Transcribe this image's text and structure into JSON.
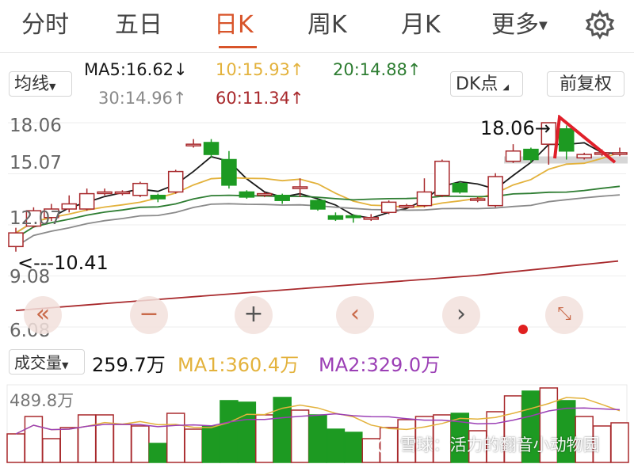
{
  "tabs": [
    {
      "label": "分时",
      "active": false
    },
    {
      "label": "五日",
      "active": false
    },
    {
      "label": "日K",
      "active": true
    },
    {
      "label": "周K",
      "active": false
    },
    {
      "label": "月K",
      "active": false
    },
    {
      "label": "更多",
      "active": false
    }
  ],
  "toolbar": {
    "indicator_label": "均线",
    "dk_label": "DK点",
    "adjust_label": "前复权",
    "ma5": "MA5:16.62↓",
    "ma10": "10:15.93↑",
    "ma20": "20:14.88↑",
    "ma30": "30:14.96↑",
    "ma60": "60:11.34↑"
  },
  "price_axis": [
    "18.06",
    "15.07",
    "12.07",
    "9.08",
    "6.08"
  ],
  "annotations": {
    "high": "18.06→",
    "low": "<---10.41"
  },
  "volume": {
    "label": "成交量",
    "value": "259.7万",
    "ma1": "MA1:360.4万",
    "ma2": "MA2:329.0万",
    "axis_max": "489.8万"
  },
  "watermark": "雪球：活力的翻音小动物园",
  "colors": {
    "up": "#a8292c",
    "down": "#1d9a22",
    "accent": "#d8542a",
    "ma5": "#1a1a1a",
    "ma10": "#e3b23c",
    "ma20": "#2e7d32",
    "ma30": "#8a8a8a",
    "ma60": "#a8292c",
    "vol_ma1": "#e3b23c",
    "vol_ma2": "#9b3fb5"
  },
  "icons": [
    "gear-icon",
    "double-chevron-left-icon",
    "minus-icon",
    "plus-icon",
    "chevron-left-icon",
    "chevron-right-icon",
    "expand-icon"
  ],
  "chart_data": {
    "type": "candlestick",
    "ylim": [
      6.08,
      18.06
    ],
    "candles": [
      [
        10.8,
        11.6,
        10.5,
        11.9
      ],
      [
        12.0,
        12.9,
        11.9,
        13.1
      ],
      [
        12.5,
        13.0,
        12.3,
        13.3
      ],
      [
        13.0,
        13.3,
        12.8,
        13.8
      ],
      [
        13.0,
        13.9,
        12.9,
        14.2
      ],
      [
        14.0,
        14.0,
        13.8,
        14.2
      ],
      [
        14.0,
        14.0,
        13.8,
        14.1
      ],
      [
        13.8,
        14.5,
        13.7,
        14.6
      ],
      [
        13.8,
        13.6,
        13.4,
        13.9
      ],
      [
        14.0,
        15.2,
        13.9,
        15.3
      ],
      [
        16.8,
        16.8,
        16.6,
        17.1
      ],
      [
        16.9,
        16.2,
        16.0,
        17.1
      ],
      [
        15.9,
        14.4,
        14.2,
        16.4
      ],
      [
        14.0,
        13.7,
        13.6,
        14.1
      ],
      [
        13.9,
        13.9,
        13.7,
        14.0
      ],
      [
        13.8,
        13.5,
        13.3,
        13.9
      ],
      [
        14.2,
        14.3,
        13.7,
        14.8
      ],
      [
        13.5,
        13.0,
        12.9,
        13.6
      ],
      [
        12.6,
        12.4,
        12.3,
        12.8
      ],
      [
        12.6,
        12.5,
        12.2,
        12.7
      ],
      [
        12.4,
        12.5,
        12.3,
        12.7
      ],
      [
        12.8,
        13.4,
        12.7,
        13.5
      ],
      [
        13.2,
        13.2,
        13.1,
        13.3
      ],
      [
        13.2,
        14.0,
        13.1,
        14.8
      ],
      [
        13.8,
        15.8,
        13.7,
        15.9
      ],
      [
        14.5,
        14.0,
        13.9,
        14.6
      ],
      [
        13.6,
        13.6,
        13.4,
        13.7
      ],
      [
        13.2,
        14.9,
        13.1,
        15.1
      ],
      [
        15.8,
        16.4,
        15.7,
        16.8
      ],
      [
        16.5,
        15.9,
        15.7,
        16.6
      ],
      [
        16.8,
        18.06,
        15.6,
        18.06
      ],
      [
        17.7,
        16.4,
        15.9,
        17.9
      ],
      [
        16.0,
        16.2,
        15.9,
        16.3
      ],
      [
        16.3,
        16.3,
        16.1,
        16.5
      ],
      [
        16.3,
        16.3,
        16.1,
        16.6
      ]
    ],
    "volume_max": 489.8,
    "volumes": [
      180,
      290,
      150,
      220,
      300,
      300,
      240,
      230,
      120,
      310,
      210,
      230,
      390,
      380,
      300,
      410,
      330,
      300,
      210,
      190,
      150,
      220,
      270,
      290,
      300,
      310,
      200,
      320,
      420,
      450,
      470,
      390,
      290,
      230,
      250
    ]
  }
}
